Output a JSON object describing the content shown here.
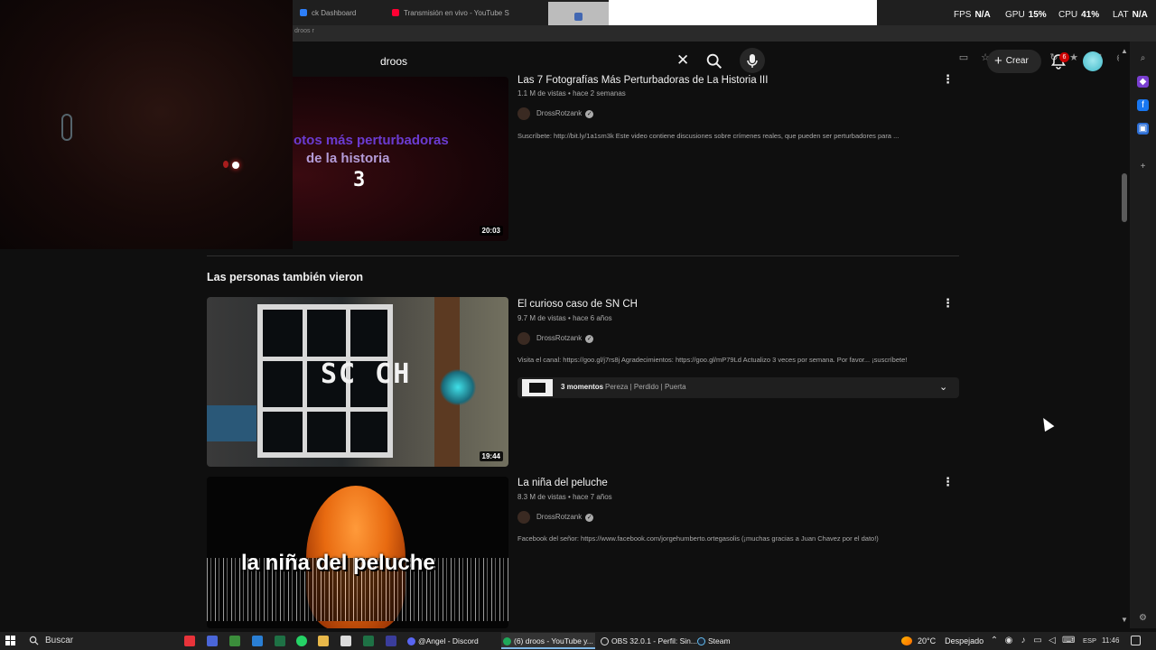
{
  "browser": {
    "tabs": [
      {
        "label": "ck Dashboard"
      },
      {
        "label": "Transmisión en vivo - YouTube S"
      }
    ],
    "address_fragment": "droos r",
    "stats": {
      "fps_label": "FPS",
      "fps_value": "N/A",
      "gpu_label": "GPU",
      "gpu_value": "15%",
      "cpu_label": "CPU",
      "cpu_value": "41%",
      "lat_label": "LAT",
      "lat_value": "N/A"
    }
  },
  "header": {
    "search_value": "droos",
    "create_label": "Crear",
    "notification_count": "6"
  },
  "videos": [
    {
      "title": "Las 7 Fotografías Más Perturbadoras de La Historia III",
      "views": "1.1 M de vistas",
      "age": "hace 2 semanas",
      "channel": "DrossRotzank",
      "description": "Suscríbete: http://bit.ly/1a1sm3k Este video contiene discusiones sobre crímenes reales, que pueden ser perturbadores para ...",
      "duration": "20:03",
      "thumb_lines": [
        "otos más perturbadoras",
        "de la historia",
        "3"
      ]
    },
    {
      "title": "El curioso caso de SN CH",
      "views": "9.7 M de vistas",
      "age": "hace 6 años",
      "channel": "DrossRotzank",
      "description": "Visita el canal: https://goo.gl/j7rs8j Agradecimientos: https://goo.gl/mP79Ld Actualizo 3 veces por semana. Por favor... ¡suscríbete!",
      "duration": "19:44",
      "thumb_text": "SC CH",
      "chapters_count": "3 momentos",
      "chapters_names": "Pereza | Perdido | Puerta"
    },
    {
      "title": "La niña del peluche",
      "views": "8.3 M de vistas",
      "age": "hace 7 años",
      "channel": "DrossRotzank",
      "description": "Facebook del señor: https://www.facebook.com/jorgehumberto.ortegasolis (¡muchas gracias a Juan Chavez por el dato!)",
      "thumb_text": "la niña del peluche"
    }
  ],
  "section_title": "Las personas también vieron",
  "meta_separator": "•",
  "taskbar": {
    "search_label": "Buscar",
    "tasks": [
      {
        "label": "@Angel - Discord"
      },
      {
        "label": "(6) droos - YouTube y..."
      },
      {
        "label": "OBS 32.0.1 - Perfil: Sin..."
      },
      {
        "label": "Steam"
      }
    ],
    "weather_temp": "20°C",
    "weather_desc": "Despejado",
    "lang": "ESP",
    "time": "11:46"
  },
  "icons": {
    "search": "search-icon",
    "clear": "close-icon",
    "mic": "microphone-icon",
    "bell": "bell-icon",
    "kebab": "more-vert-icon",
    "verified": "check-icon"
  },
  "colors": {
    "background": "#0f0f0f",
    "accent_red": "#cc0000",
    "text_secondary": "#aaaaaa"
  }
}
